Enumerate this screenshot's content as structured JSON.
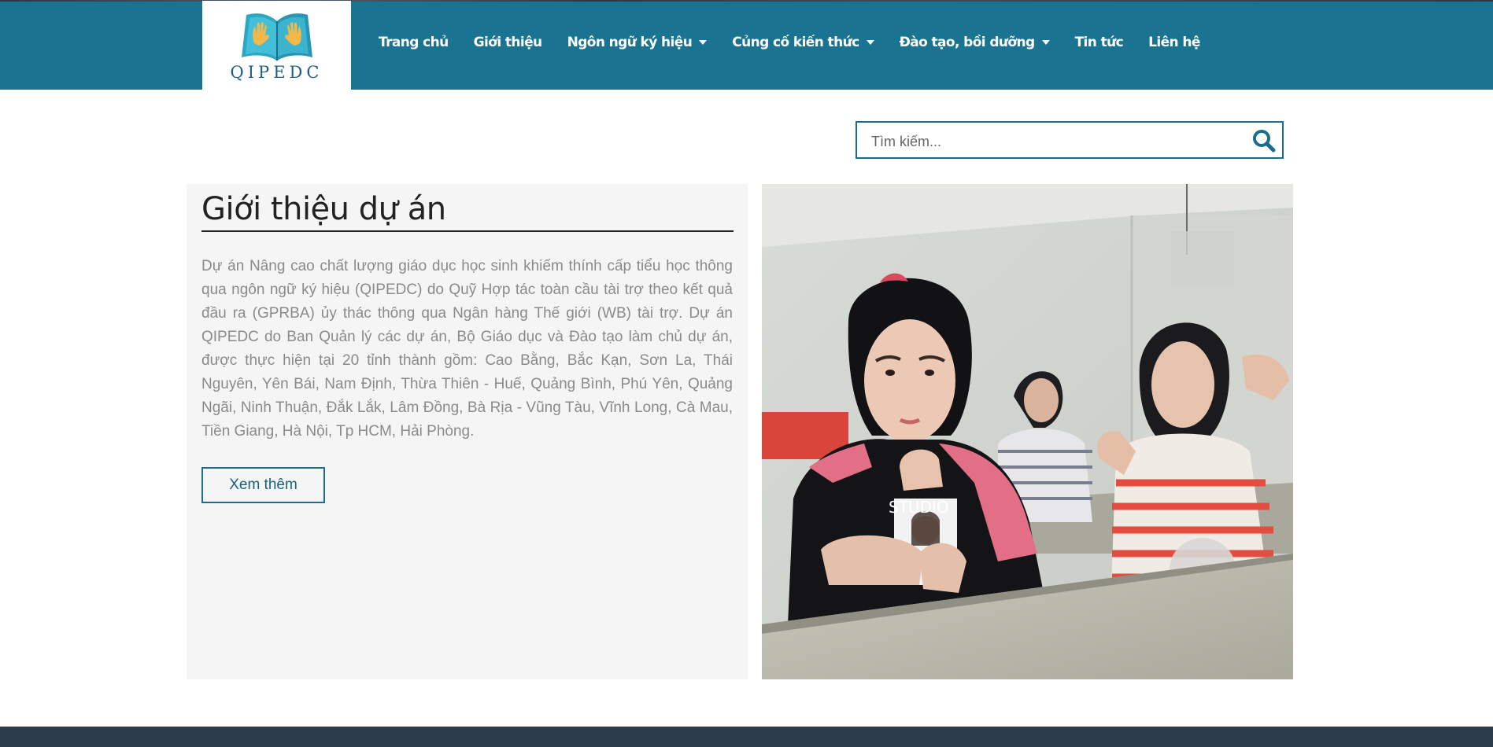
{
  "brand": {
    "logo_text": "QIPEDC"
  },
  "nav": {
    "items": [
      {
        "label": "Trang chủ",
        "has_dropdown": false
      },
      {
        "label": "Giới thiệu",
        "has_dropdown": false
      },
      {
        "label": "Ngôn ngữ ký hiệu",
        "has_dropdown": true
      },
      {
        "label": "Củng cố kiến thức",
        "has_dropdown": true
      },
      {
        "label": "Đào tạo, bồi dưỡng",
        "has_dropdown": true
      },
      {
        "label": "Tin tức",
        "has_dropdown": false
      },
      {
        "label": "Liên hệ",
        "has_dropdown": false
      }
    ]
  },
  "search": {
    "placeholder": "Tìm kiếm...",
    "value": "",
    "icon": "search-icon"
  },
  "intro": {
    "title": "Giới thiệu dự án",
    "body": "Dự án Nâng cao chất lượng giáo dục học sinh khiếm thính cấp tiểu học thông qua ngôn ngữ ký hiệu (QIPEDC) do Quỹ Hợp tác toàn cầu tài trợ theo kết quả đầu ra (GPRBA) ủy thác thông qua Ngân hàng Thế giới (WB) tài trợ. Dự án QIPEDC do Ban Quản lý các dự án, Bộ Giáo dục và Đào tạo làm chủ dự án, được thực hiện tại 20 tỉnh thành gồm: Cao Bằng, Bắc Kạn, Sơn La, Thái Nguyên, Yên Bái, Nam Định, Thừa Thiên - Huế, Quảng Bình, Phú Yên, Quảng Ngãi, Ninh Thuận, Đắk Lắk, Lâm Đồng, Bà Rịa - Vũng Tàu, Vĩnh Long, Cà Mau, Tiền Giang, Hà Nội, Tp HCM, Hải Phòng.",
    "button_label": "Xem thêm"
  },
  "photo": {
    "shirt_text": "STUDIO"
  },
  "colors": {
    "primary": "#1a7391",
    "footer": "#2d3c4b",
    "panel": "#f5f5f5"
  }
}
